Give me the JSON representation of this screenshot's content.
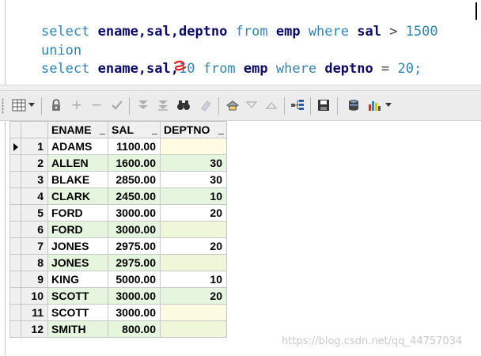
{
  "editor": {
    "line1": {
      "t1": "select",
      "t2": " ",
      "t3": "ename,sal,deptno",
      "t4": " ",
      "t5": "from",
      "t6": " ",
      "t7": "emp",
      "t8": " ",
      "t9": "where",
      "t10": " ",
      "t11": "sal",
      "t12": " > ",
      "t13": "1500"
    },
    "line2": {
      "t1": "union"
    },
    "line3": {
      "t1": "select",
      "t2": " ",
      "t3": "ename,sal,",
      "t4": "10",
      "t5": " ",
      "t6": "from",
      "t7": " ",
      "t8": "emp",
      "t9": " ",
      "t10": "where",
      "t11": " ",
      "t12": "deptno",
      "t13": " = ",
      "t14": "20;"
    },
    "annotation_color": "#e0201c"
  },
  "toolbar": {
    "icons": [
      "grid-layout-icon",
      "dropdown-arrow-icon",
      "lock-icon",
      "add-record-icon",
      "delete-record-icon",
      "post-check-icon",
      "filter-down-icon",
      "filter-clear-icon",
      "find-binoculars-icon",
      "clear-eraser-icon",
      "print-icon",
      "sort-down-icon",
      "sort-up-icon",
      "tree-icon",
      "save-icon",
      "database-icon",
      "chart-icon",
      "dropdown-arrow-icon"
    ]
  },
  "grid": {
    "columns": [
      "ENAME",
      "SAL",
      "DEPTNO"
    ],
    "rows": [
      {
        "n": "1",
        "ename": "ADAMS",
        "sal": "1100.00",
        "deptno": ""
      },
      {
        "n": "2",
        "ename": "ALLEN",
        "sal": "1600.00",
        "deptno": "30"
      },
      {
        "n": "3",
        "ename": "BLAKE",
        "sal": "2850.00",
        "deptno": "30"
      },
      {
        "n": "4",
        "ename": "CLARK",
        "sal": "2450.00",
        "deptno": "10"
      },
      {
        "n": "5",
        "ename": "FORD",
        "sal": "3000.00",
        "deptno": "20"
      },
      {
        "n": "6",
        "ename": "FORD",
        "sal": "3000.00",
        "deptno": ""
      },
      {
        "n": "7",
        "ename": "JONES",
        "sal": "2975.00",
        "deptno": "20"
      },
      {
        "n": "8",
        "ename": "JONES",
        "sal": "2975.00",
        "deptno": ""
      },
      {
        "n": "9",
        "ename": "KING",
        "sal": "5000.00",
        "deptno": "10"
      },
      {
        "n": "10",
        "ename": "SCOTT",
        "sal": "3000.00",
        "deptno": "20"
      },
      {
        "n": "11",
        "ename": "SCOTT",
        "sal": "3000.00",
        "deptno": ""
      },
      {
        "n": "12",
        "ename": "SMITH",
        "sal": "800.00",
        "deptno": ""
      }
    ],
    "current_row": "1"
  },
  "watermark": "https://blog.csdn.net/qq_44757034"
}
